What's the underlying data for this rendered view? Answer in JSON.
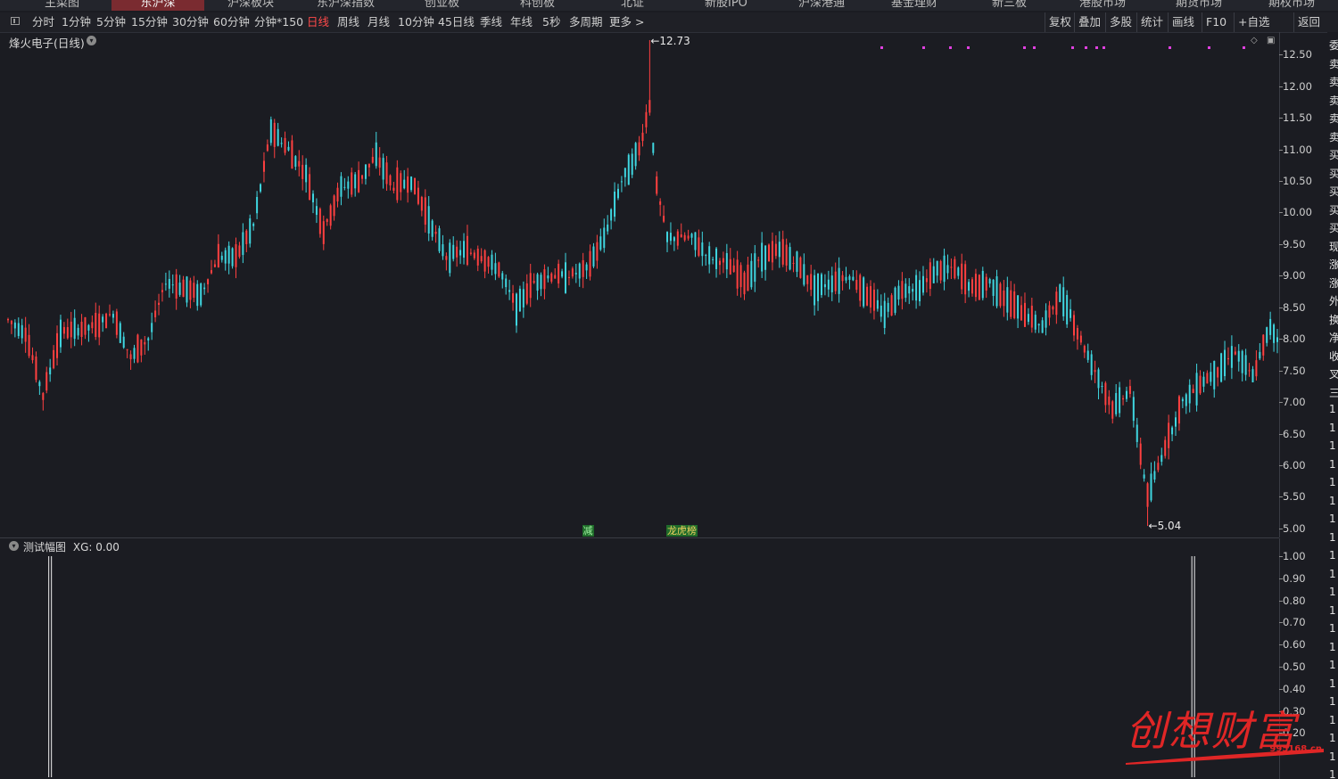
{
  "topnav": {
    "tabs": [
      {
        "label": "主菜图",
        "x": 50
      },
      {
        "label": "东沪深",
        "x": 150,
        "active": true
      },
      {
        "label": "沪深板块",
        "x": 255
      },
      {
        "label": "东沪深指数",
        "x": 355
      },
      {
        "label": "创业板",
        "x": 476
      },
      {
        "label": "科创板",
        "x": 583
      },
      {
        "label": "北证",
        "x": 696
      },
      {
        "label": "新股IPO",
        "x": 790
      },
      {
        "label": "沪深港通",
        "x": 895
      },
      {
        "label": "基金理财",
        "x": 999
      },
      {
        "label": "新三板",
        "x": 1112
      },
      {
        "label": "港股市场",
        "x": 1210
      },
      {
        "label": "期货市场",
        "x": 1318
      },
      {
        "label": "期权市场",
        "x": 1422
      }
    ]
  },
  "toolbar": {
    "periods": [
      "分时",
      "1分钟",
      "5分钟",
      "15分钟",
      "30分钟",
      "60分钟",
      "分钟*150",
      "日线",
      "周线",
      "月线",
      "10分钟",
      "45日线",
      "季线",
      "年线",
      "5秒",
      "多周期",
      "更多 >"
    ],
    "active_period": "日线",
    "right_buttons": [
      "复权",
      "叠加",
      "多股",
      "统计",
      "画线",
      "F10",
      "+自选",
      "返回"
    ]
  },
  "main_chart": {
    "title": "烽火电子(日线)",
    "high_label": "12.73",
    "low_label": "5.04",
    "y_ticks": [
      "12.50",
      "12.00",
      "11.50",
      "11.00",
      "10.50",
      "10.00",
      "9.50",
      "9.00",
      "8.50",
      "8.00",
      "7.50",
      "7.00",
      "6.50",
      "6.00",
      "5.50",
      "5.00"
    ],
    "markers": [
      {
        "text": "减"
      },
      {
        "text": "龙虎榜"
      }
    ]
  },
  "indicator": {
    "title": "测试幅图",
    "xg_label": "XG: 0.00",
    "y_ticks": [
      "1.00",
      "0.90",
      "0.80",
      "0.70",
      "0.60",
      "0.50",
      "0.40",
      "0.30",
      "0.20"
    ]
  },
  "right_strip": [
    "委",
    "卖",
    "卖",
    "卖",
    "卖",
    "卖",
    "买",
    "买",
    "买",
    "买",
    "买",
    "现",
    "涨",
    "涨",
    "外",
    "换",
    "净",
    "收",
    "叉",
    "三",
    "1",
    "1",
    "1",
    "1",
    "1",
    "1",
    "1",
    "1",
    "1",
    "1",
    "1",
    "1",
    "1",
    "1",
    "1",
    "1",
    "1",
    "1",
    "1",
    "1",
    "1"
  ],
  "watermark": {
    "text": "创想财富",
    "url": "995168.cn"
  },
  "colors": {
    "up": "#ff4040",
    "down": "#3fd6e0",
    "active": "#ff4a4a",
    "magenta": "#e040e0"
  },
  "chart_data": {
    "type": "candlestick",
    "ylim": [
      4.9,
      12.8
    ],
    "anchors": [
      [
        0,
        8.3
      ],
      [
        5,
        8.1
      ],
      [
        10,
        7.1
      ],
      [
        15,
        8.1
      ],
      [
        25,
        8.2
      ],
      [
        30,
        8.4
      ],
      [
        35,
        7.7
      ],
      [
        40,
        8.0
      ],
      [
        45,
        8.9
      ],
      [
        50,
        8.8
      ],
      [
        55,
        8.7
      ],
      [
        60,
        9.3
      ],
      [
        65,
        9.3
      ],
      [
        70,
        9.8
      ],
      [
        75,
        11.3
      ],
      [
        80,
        11.0
      ],
      [
        85,
        10.6
      ],
      [
        90,
        9.7
      ],
      [
        95,
        10.4
      ],
      [
        100,
        10.5
      ],
      [
        105,
        10.9
      ],
      [
        110,
        10.4
      ],
      [
        115,
        10.5
      ],
      [
        120,
        9.9
      ],
      [
        125,
        9.3
      ],
      [
        130,
        9.4
      ],
      [
        135,
        9.3
      ],
      [
        140,
        9.1
      ],
      [
        145,
        8.5
      ],
      [
        150,
        8.9
      ],
      [
        155,
        9.0
      ],
      [
        160,
        9.0
      ],
      [
        165,
        9.1
      ],
      [
        170,
        9.6
      ],
      [
        175,
        10.5
      ],
      [
        180,
        11.0
      ],
      [
        183,
        11.7
      ],
      [
        185,
        10.4
      ],
      [
        188,
        9.6
      ],
      [
        195,
        9.6
      ],
      [
        200,
        9.3
      ],
      [
        205,
        9.2
      ],
      [
        210,
        8.9
      ],
      [
        215,
        9.3
      ],
      [
        220,
        9.4
      ],
      [
        225,
        9.2
      ],
      [
        230,
        8.8
      ],
      [
        235,
        8.9
      ],
      [
        240,
        9.0
      ],
      [
        245,
        8.7
      ],
      [
        250,
        8.4
      ],
      [
        255,
        8.8
      ],
      [
        260,
        8.8
      ],
      [
        265,
        9.1
      ],
      [
        270,
        9.1
      ],
      [
        275,
        8.8
      ],
      [
        280,
        8.9
      ],
      [
        285,
        8.6
      ],
      [
        290,
        8.4
      ],
      [
        295,
        8.2
      ],
      [
        300,
        8.7
      ],
      [
        303,
        8.4
      ],
      [
        305,
        8.1
      ],
      [
        310,
        7.5
      ],
      [
        315,
        6.9
      ],
      [
        320,
        7.2
      ],
      [
        325,
        5.5
      ],
      [
        330,
        6.3
      ],
      [
        335,
        7.0
      ],
      [
        340,
        7.3
      ],
      [
        345,
        7.5
      ],
      [
        350,
        7.8
      ],
      [
        355,
        7.4
      ],
      [
        360,
        8.2
      ],
      [
        362,
        8.0
      ]
    ],
    "bar_count": 363,
    "signal_bars": [
      12,
      338
    ]
  }
}
